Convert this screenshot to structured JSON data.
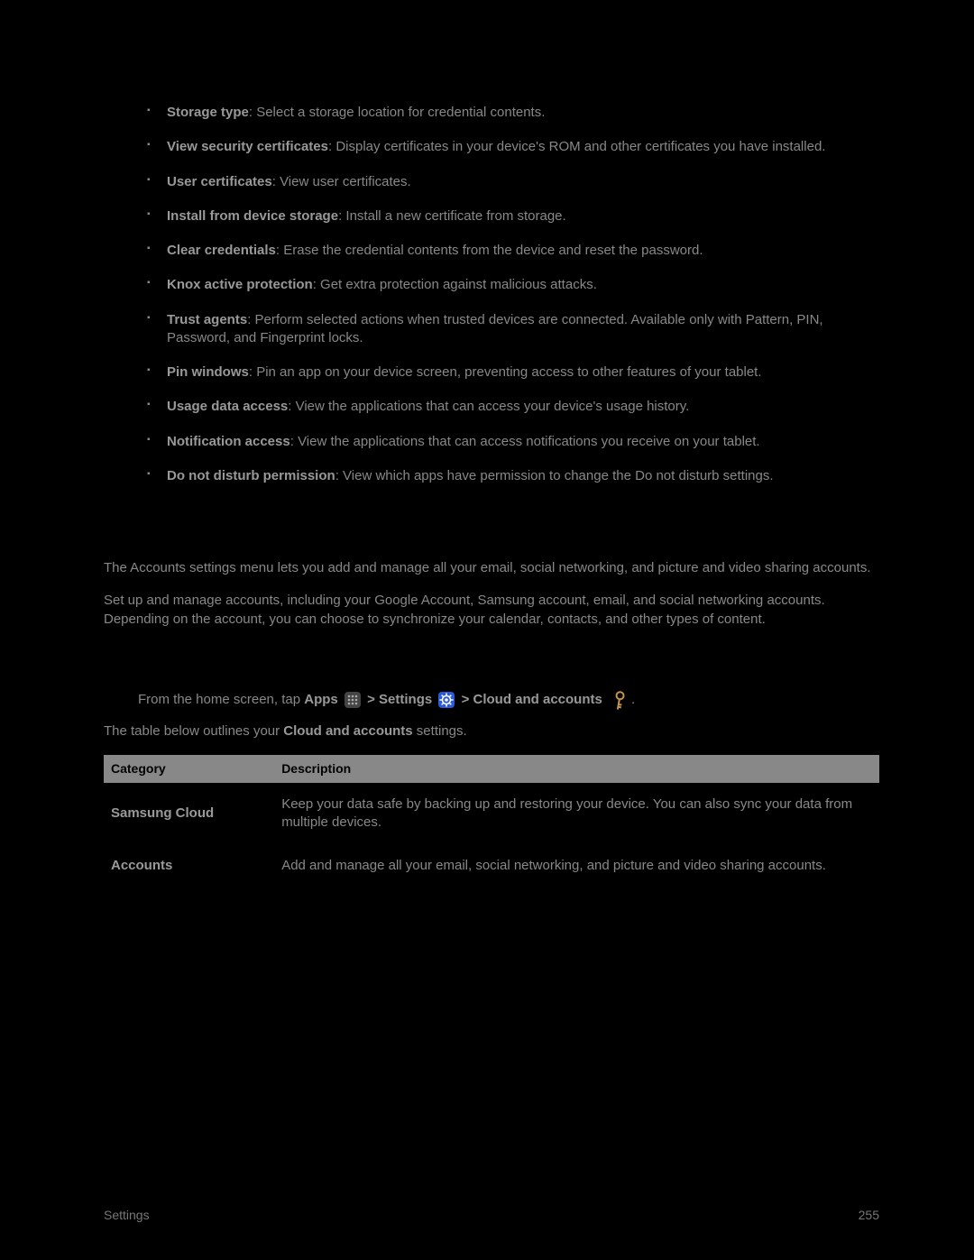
{
  "bullets": [
    {
      "term": "Storage type",
      "desc": "Select a storage location for credential contents."
    },
    {
      "term": "View security certificates",
      "desc": "Display certificates in your device's ROM and other certificates you have installed."
    },
    {
      "term": "User certificates",
      "desc": "View user certificates."
    },
    {
      "term": "Install from device storage",
      "desc": "Install a new certificate from storage."
    },
    {
      "term": "Clear credentials",
      "desc": "Erase the credential contents from the device and reset the password."
    },
    {
      "term": "Knox active protection",
      "desc": "Get extra protection against malicious attacks."
    },
    {
      "term": "Trust agents",
      "desc": "Perform selected actions when trusted devices are connected. Available only with Pattern, PIN, Password, and Fingerprint locks."
    },
    {
      "term": "Pin windows",
      "desc": "Pin an app on your device screen, preventing access to other features of your tablet."
    },
    {
      "term": "Usage data access",
      "desc": "View the applications that can access your device's usage history."
    },
    {
      "term": "Notification access",
      "desc": "View the applications that can access notifications you receive on your tablet."
    },
    {
      "term": "Do not disturb permission",
      "desc": "View which apps have permission to change the Do not disturb settings."
    }
  ],
  "paras": {
    "p1": "The Accounts settings menu lets you add and manage all your email, social networking, and picture and video sharing accounts.",
    "p2": "Set up and manage accounts, including your Google Account, Samsung account, email, and social networking accounts. Depending on the account, you can choose to synchronize your calendar, contacts, and other types of content."
  },
  "nav": {
    "prefix": "From the home screen, tap ",
    "apps": "Apps",
    "sep1": " > ",
    "settings": "Settings",
    "sep2": " > ",
    "cloud": "Cloud and accounts",
    "suffix": "."
  },
  "table_intro": {
    "pre": "The table below outlines your ",
    "strong": "Cloud and accounts",
    "post": " settings."
  },
  "table": {
    "headers": {
      "cat": "Category",
      "desc": "Description"
    },
    "rows": [
      {
        "cat": "Samsung Cloud",
        "desc": "Keep your data safe by backing up and restoring your device. You can also sync your data from multiple devices."
      },
      {
        "cat": "Accounts",
        "desc": "Add and manage all your email, social networking, and picture and video sharing accounts."
      }
    ]
  },
  "footer": {
    "left": "Settings",
    "right": "255"
  }
}
